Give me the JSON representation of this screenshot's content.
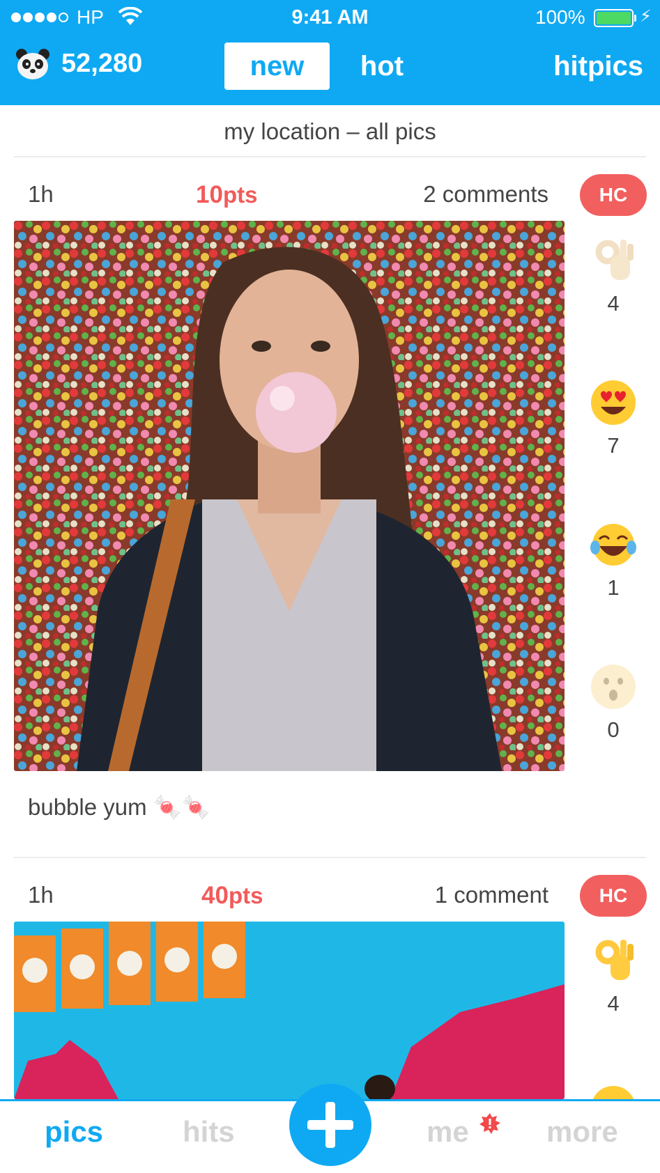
{
  "status_bar": {
    "carrier": "HP",
    "time": "9:41 AM",
    "battery": "100%"
  },
  "header": {
    "score": "52,280",
    "tabs": {
      "new": "new",
      "hot": "hot"
    },
    "brand": "hitpics"
  },
  "location": "my location – all pics",
  "posts": [
    {
      "age": "1h",
      "points_value": "10",
      "points_unit": "pts",
      "comments": "2 comments",
      "badge": "HC",
      "caption": "bubble yum 🍬🍬",
      "reactions": [
        {
          "icon": "ok-hand-icon",
          "count": "4"
        },
        {
          "icon": "heart-eyes-icon",
          "count": "7"
        },
        {
          "icon": "tears-of-joy-icon",
          "count": "1"
        },
        {
          "icon": "surprised-face-icon",
          "count": "0"
        }
      ]
    },
    {
      "age": "1h",
      "points_value": "40",
      "points_unit": "pts",
      "comments": "1 comment",
      "badge": "HC",
      "reactions": [
        {
          "icon": "ok-hand-icon",
          "count": "4"
        }
      ]
    }
  ],
  "tabbar": {
    "pics": "pics",
    "hits": "hits",
    "me": "me",
    "more": "more"
  },
  "colors": {
    "brand_blue": "#0fa9f3",
    "points_red": "#f25a5a",
    "badge_red": "#f25f5f",
    "inactive_gray": "#d4d4d4"
  }
}
